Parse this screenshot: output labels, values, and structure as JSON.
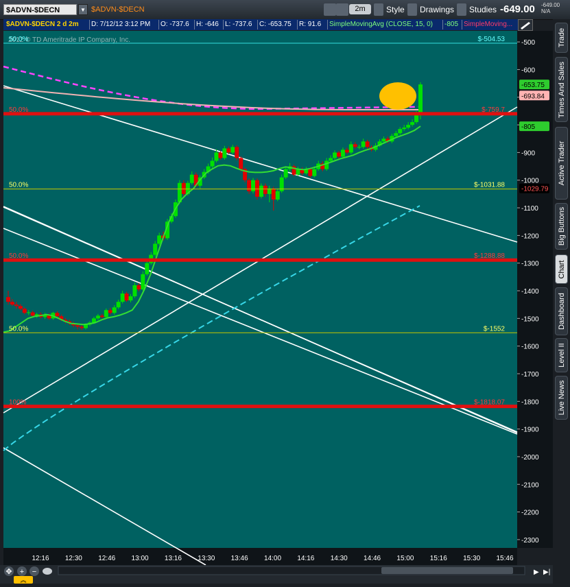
{
  "toolbar": {
    "symbol": "$ADVN-$DECN",
    "linked_symbol": "$ADVN-$DECN",
    "timeframe": "2m",
    "style_label": "Style",
    "drawings_label": "Drawings",
    "studies_label": "Studies",
    "last_price": "-649.00",
    "small_price": "-649.00",
    "small_change": "N/A"
  },
  "infobar": {
    "title": "$ADVN-$DECN 2 d 2m",
    "date": "D: 7/12/12 3:12 PM",
    "open": "O: -737.6",
    "high": "H: -646",
    "low": "L: -737.6",
    "close": "C: -653.75",
    "r": "R: 91.6",
    "study": "SimpleMovingAvg (CLOSE, 15, 0)",
    "study_value": "-805",
    "study2": "SimpleMoving..."
  },
  "watermark": "2012 © TD Ameritrade IP Company, Inc.",
  "sidebar_tabs": [
    "Trade",
    "Times And Sales",
    "Active Trader",
    "Big Buttons",
    "Chart",
    "Dashboard",
    "Level II",
    "Live News"
  ],
  "colors": {
    "background": "#006161",
    "up_candle": "#00e000",
    "down_candle": "#e00000",
    "sma_line": "#33dd33",
    "cyan_dashed": "#37d7e8",
    "magenta_dashed": "#ff44ff",
    "fib_red": "#e01010",
    "fib_yellow": "#c8c800",
    "highlight_ellipse": "#ffc000"
  },
  "chart_data": {
    "type": "candlestick",
    "x_ticks": [
      "12:16",
      "12:30",
      "12:46",
      "13:00",
      "13:16",
      "13:30",
      "13:46",
      "14:00",
      "14:16",
      "14:30",
      "14:46",
      "15:00",
      "15:16",
      "15:30",
      "15:46"
    ],
    "y_ticks": [
      -500,
      -600,
      -700,
      -800,
      -900,
      -1000,
      -1100,
      -1200,
      -1300,
      -1400,
      -1500,
      -1600,
      -1700,
      -1800,
      -1900,
      -2000,
      -2100,
      -2200,
      -2300
    ],
    "ylim": [
      -2330,
      -460
    ],
    "price_labels": [
      {
        "value": -653.75,
        "text": "-653.75",
        "kind": "last"
      },
      {
        "value": -693.84,
        "text": "-693.84",
        "kind": "pink"
      },
      {
        "value": -805,
        "text": "-805",
        "kind": "sma"
      },
      {
        "value": -1029.79,
        "text": "-1029.79",
        "kind": "cyan"
      }
    ],
    "fib_levels": [
      {
        "value": -504.53,
        "color": "cyan",
        "left": "50.0%",
        "right": "$-504.53"
      },
      {
        "value": -759.7,
        "color": "red",
        "left": "50.0%",
        "right": "$-759.7"
      },
      {
        "value": -1031.88,
        "color": "yellow",
        "left": "50.0%",
        "right": "$-1031.88"
      },
      {
        "value": -1288.88,
        "color": "red",
        "left": "50.0%",
        "right": "$-1288.88"
      },
      {
        "value": -1552,
        "color": "yellow",
        "left": "50.0%",
        "right": "$-1552"
      },
      {
        "value": -1818.07,
        "color": "red",
        "left": "100%",
        "right": "$-1818.07"
      }
    ],
    "ohlc": [
      [
        -1423,
        -1440,
        -1400,
        -1450
      ],
      [
        -1440,
        -1450,
        -1430,
        -1455
      ],
      [
        -1450,
        -1455,
        -1440,
        -1465
      ],
      [
        -1455,
        -1465,
        -1448,
        -1470
      ],
      [
        -1465,
        -1480,
        -1460,
        -1485
      ],
      [
        -1480,
        -1478,
        -1470,
        -1488
      ],
      [
        -1478,
        -1490,
        -1472,
        -1495
      ],
      [
        -1490,
        -1485,
        -1480,
        -1498
      ],
      [
        -1485,
        -1495,
        -1478,
        -1500
      ],
      [
        -1495,
        -1488,
        -1480,
        -1502
      ],
      [
        -1488,
        -1500,
        -1482,
        -1505
      ],
      [
        -1500,
        -1480,
        -1476,
        -1505
      ],
      [
        -1480,
        -1492,
        -1474,
        -1498
      ],
      [
        -1492,
        -1505,
        -1486,
        -1510
      ],
      [
        -1505,
        -1510,
        -1498,
        -1518
      ],
      [
        -1510,
        -1518,
        -1504,
        -1524
      ],
      [
        -1518,
        -1525,
        -1512,
        -1532
      ],
      [
        -1525,
        -1530,
        -1520,
        -1540
      ],
      [
        -1530,
        -1535,
        -1524,
        -1542
      ],
      [
        -1535,
        -1522,
        -1518,
        -1540
      ],
      [
        -1522,
        -1515,
        -1510,
        -1528
      ],
      [
        -1515,
        -1500,
        -1494,
        -1520
      ],
      [
        -1500,
        -1490,
        -1484,
        -1506
      ],
      [
        -1490,
        -1495,
        -1484,
        -1500
      ],
      [
        -1495,
        -1470,
        -1464,
        -1500
      ],
      [
        -1470,
        -1480,
        -1462,
        -1486
      ],
      [
        -1480,
        -1460,
        -1452,
        -1486
      ],
      [
        -1460,
        -1440,
        -1432,
        -1466
      ],
      [
        -1440,
        -1410,
        -1400,
        -1446
      ],
      [
        -1410,
        -1435,
        -1404,
        -1440
      ],
      [
        -1435,
        -1420,
        -1412,
        -1442
      ],
      [
        -1420,
        -1380,
        -1370,
        -1426
      ],
      [
        -1380,
        -1395,
        -1372,
        -1402
      ],
      [
        -1395,
        -1340,
        -1330,
        -1400
      ],
      [
        -1340,
        -1300,
        -1290,
        -1346
      ],
      [
        -1300,
        -1270,
        -1260,
        -1306
      ],
      [
        -1270,
        -1230,
        -1220,
        -1276
      ],
      [
        -1230,
        -1200,
        -1190,
        -1236
      ],
      [
        -1200,
        -1210,
        -1186,
        -1218
      ],
      [
        -1210,
        -1150,
        -1140,
        -1216
      ],
      [
        -1150,
        -1130,
        -1120,
        -1156
      ],
      [
        -1130,
        -1080,
        -1070,
        -1136
      ],
      [
        -1080,
        -1010,
        -1000,
        -1086
      ],
      [
        -1010,
        -1050,
        -1000,
        -1060
      ],
      [
        -1050,
        -1010,
        -1002,
        -1056
      ],
      [
        -1010,
        -980,
        -968,
        -1016
      ],
      [
        -980,
        -1020,
        -972,
        -1026
      ],
      [
        -1020,
        -990,
        -982,
        -1030
      ],
      [
        -990,
        -970,
        -960,
        -996
      ],
      [
        -970,
        -950,
        -940,
        -976
      ],
      [
        -950,
        -930,
        -918,
        -956
      ],
      [
        -930,
        -900,
        -888,
        -936
      ],
      [
        -900,
        -920,
        -894,
        -926
      ],
      [
        -920,
        -885,
        -876,
        -926
      ],
      [
        -885,
        -900,
        -878,
        -906
      ],
      [
        -900,
        -880,
        -872,
        -906
      ],
      [
        -880,
        -920,
        -874,
        -928
      ],
      [
        -920,
        -960,
        -914,
        -968
      ],
      [
        -960,
        -1000,
        -954,
        -1008
      ],
      [
        -1000,
        -1040,
        -994,
        -1050
      ],
      [
        -1040,
        -1000,
        -992,
        -1048
      ],
      [
        -1000,
        -1060,
        -994,
        -1070
      ],
      [
        -1060,
        -1020,
        -1012,
        -1066
      ],
      [
        -1020,
        -1050,
        -1012,
        -1060
      ],
      [
        -1050,
        -1030,
        -1020,
        -1080
      ],
      [
        -1030,
        -1070,
        -1024,
        -1110
      ],
      [
        -1070,
        -1040,
        -1032,
        -1076
      ],
      [
        -1040,
        -990,
        -980,
        -1046
      ],
      [
        -990,
        -960,
        -950,
        -996
      ],
      [
        -960,
        -950,
        -938,
        -970
      ],
      [
        -950,
        -980,
        -944,
        -986
      ],
      [
        -980,
        -960,
        -952,
        -986
      ],
      [
        -960,
        -975,
        -954,
        -982
      ],
      [
        -975,
        -960,
        -952,
        -980
      ],
      [
        -960,
        -985,
        -954,
        -992
      ],
      [
        -985,
        -960,
        -950,
        -990
      ],
      [
        -960,
        -940,
        -930,
        -966
      ],
      [
        -940,
        -960,
        -932,
        -968
      ],
      [
        -960,
        -930,
        -920,
        -966
      ],
      [
        -930,
        -920,
        -910,
        -936
      ],
      [
        -920,
        -900,
        -892,
        -926
      ],
      [
        -900,
        -915,
        -894,
        -922
      ],
      [
        -915,
        -890,
        -882,
        -920
      ],
      [
        -890,
        -900,
        -882,
        -906
      ],
      [
        -900,
        -870,
        -860,
        -906
      ],
      [
        -870,
        -880,
        -862,
        -886
      ],
      [
        -880,
        -880,
        -872,
        -888
      ],
      [
        -880,
        -860,
        -850,
        -886
      ],
      [
        -860,
        -880,
        -854,
        -888
      ],
      [
        -880,
        -890,
        -874,
        -896
      ],
      [
        -890,
        -875,
        -866,
        -896
      ],
      [
        -875,
        -860,
        -852,
        -880
      ],
      [
        -860,
        -850,
        -842,
        -866
      ],
      [
        -850,
        -860,
        -842,
        -866
      ],
      [
        -860,
        -840,
        -832,
        -866
      ],
      [
        -840,
        -830,
        -822,
        -846
      ],
      [
        -830,
        -815,
        -808,
        -836
      ],
      [
        -815,
        -810,
        -800,
        -822
      ],
      [
        -810,
        -800,
        -790,
        -816
      ],
      [
        -800,
        -790,
        -780,
        -806
      ],
      [
        -790,
        -760,
        -750,
        -796
      ],
      [
        -760,
        -653.75,
        -646,
        -780
      ]
    ],
    "sma": [
      -1550,
      -1545,
      -1530,
      -1515,
      -1500,
      -1493,
      -1490,
      -1486,
      -1490,
      -1500,
      -1510,
      -1518,
      -1520,
      -1522,
      -1520,
      -1515,
      -1505,
      -1498,
      -1494,
      -1488,
      -1480,
      -1470,
      -1440,
      -1395,
      -1340,
      -1275,
      -1210,
      -1150,
      -1105,
      -1070,
      -1048,
      -1030,
      -1000,
      -975,
      -960,
      -948,
      -945,
      -948,
      -957,
      -965,
      -970,
      -972,
      -972,
      -970,
      -966,
      -958,
      -952,
      -955,
      -960,
      -962,
      -958,
      -952,
      -945,
      -938,
      -930,
      -922,
      -916,
      -910,
      -900,
      -892,
      -885,
      -876,
      -866,
      -856,
      -846,
      -838,
      -830,
      -820,
      -805
    ]
  }
}
